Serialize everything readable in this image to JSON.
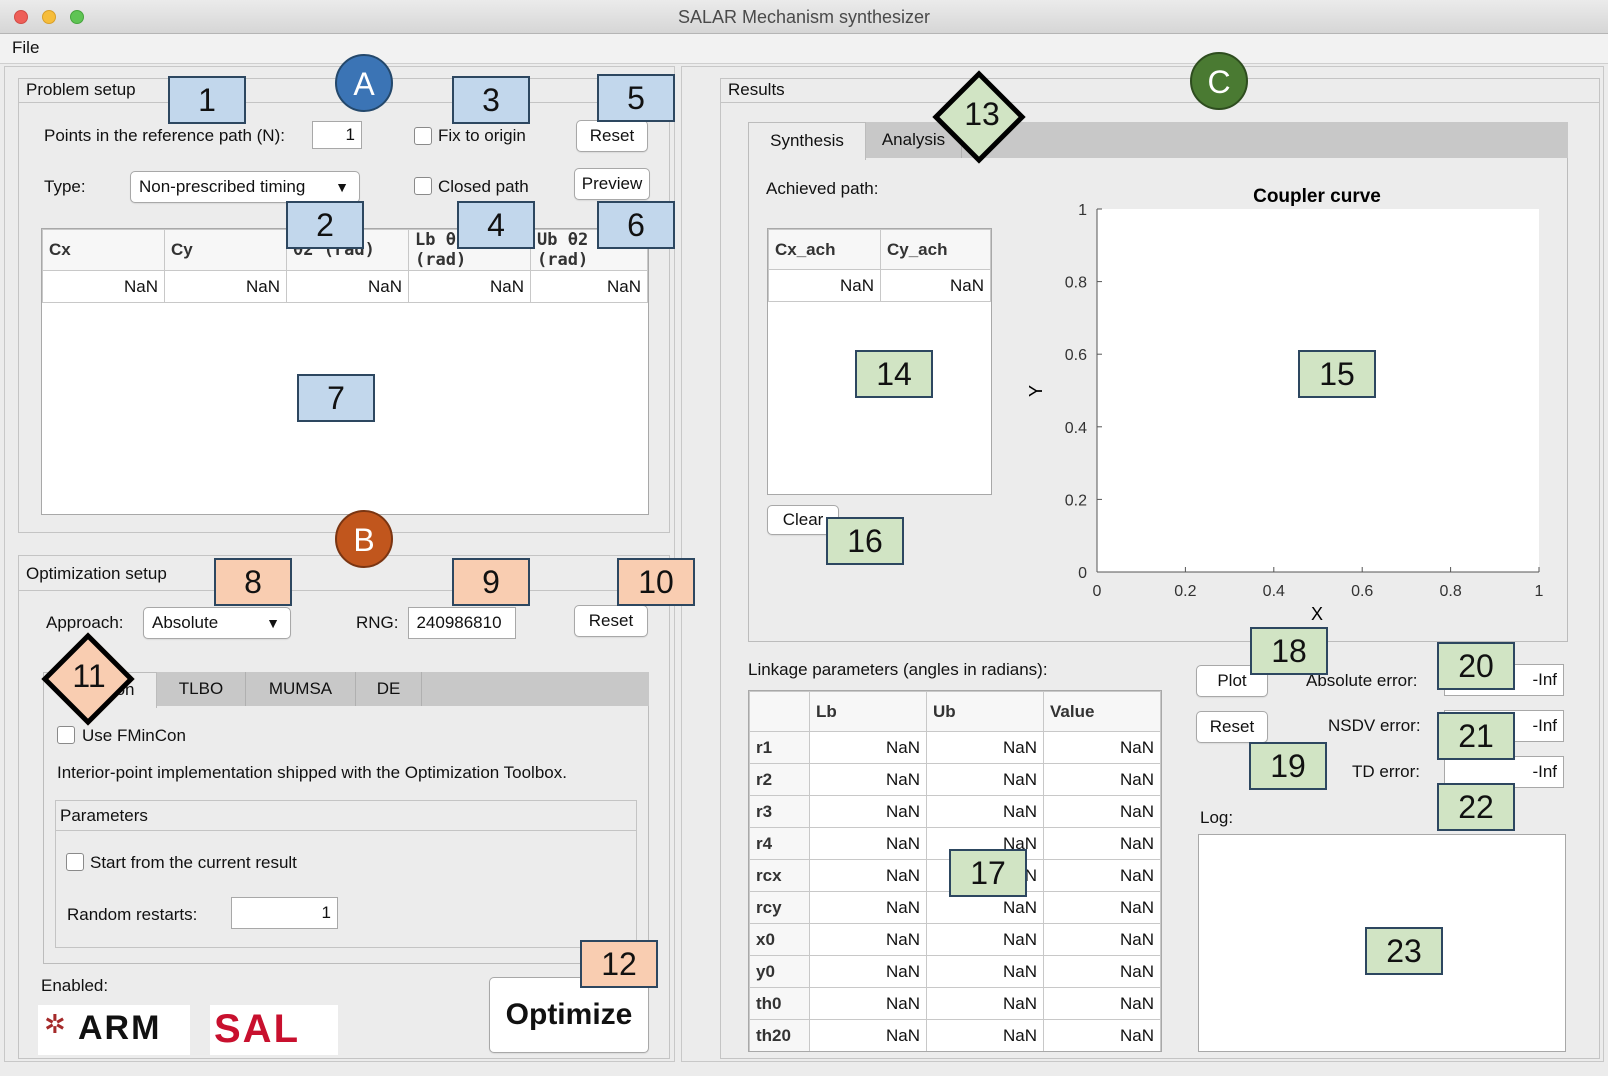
{
  "window": {
    "title": "SALAR Mechanism synthesizer"
  },
  "menu": {
    "file": "File"
  },
  "problem": {
    "title": "Problem setup",
    "points_label": "Points in the reference path (N):",
    "points_value": "1",
    "fix_origin": "Fix to origin",
    "reset": "Reset",
    "type_label": "Type:",
    "type_value": "Non-prescribed timing",
    "closed_path": "Closed path",
    "preview": "Preview",
    "table": {
      "headers": [
        "Cx",
        "Cy",
        "θ2 (rad)",
        "Lb θ2 (rad)",
        "Ub θ2 (rad)"
      ],
      "row": [
        "NaN",
        "NaN",
        "NaN",
        "NaN",
        "NaN"
      ]
    }
  },
  "optim": {
    "title": "Optimization setup",
    "approach_label": "Approach:",
    "approach_value": "Absolute",
    "rng_label": "RNG:",
    "rng_value": "240986810",
    "reset": "Reset",
    "tabs": [
      "FMinCon",
      "TLBO",
      "MUMSA",
      "DE"
    ],
    "use_fmincon": "Use FMinCon",
    "desc": "Interior-point implementation shipped with the Optimization Toolbox.",
    "params_title": "Parameters",
    "start_current": "Start from the current result",
    "restarts_label": "Random restarts:",
    "restarts_value": "1",
    "enabled": "Enabled:",
    "optimize": "Optimize",
    "logos": [
      "ARM",
      "SAL"
    ]
  },
  "results": {
    "title": "Results",
    "tabs": [
      "Synthesis",
      "Analysis"
    ],
    "achieved": "Achieved path:",
    "ach_table": {
      "headers": [
        "Cx_ach",
        "Cy_ach"
      ],
      "row": [
        "NaN",
        "NaN"
      ]
    },
    "clear": "Clear",
    "linkage_label": "Linkage parameters (angles in radians):",
    "linkage": {
      "headers": [
        "",
        "Lb",
        "Ub",
        "Value"
      ],
      "rows": [
        [
          "r1",
          "NaN",
          "NaN",
          "NaN"
        ],
        [
          "r2",
          "NaN",
          "NaN",
          "NaN"
        ],
        [
          "r3",
          "NaN",
          "NaN",
          "NaN"
        ],
        [
          "r4",
          "NaN",
          "NaN",
          "NaN"
        ],
        [
          "rcx",
          "NaN",
          "NaN",
          "NaN"
        ],
        [
          "rcy",
          "NaN",
          "NaN",
          "NaN"
        ],
        [
          "x0",
          "NaN",
          "NaN",
          "NaN"
        ],
        [
          "y0",
          "NaN",
          "NaN",
          "NaN"
        ],
        [
          "th0",
          "NaN",
          "NaN",
          "NaN"
        ],
        [
          "th20",
          "NaN",
          "NaN",
          "NaN"
        ]
      ]
    },
    "plot": "Plot",
    "reset": "Reset",
    "abs_error_label": "Absolute error:",
    "abs_error": "-Inf",
    "nsdv_label": "NSDV error:",
    "nsdv_error": "-Inf",
    "td_label": "TD error:",
    "td_error": "-Inf",
    "log_label": "Log:"
  },
  "chart_data": {
    "type": "line",
    "title": "Coupler curve",
    "xlabel": "X",
    "ylabel": "Y",
    "xlim": [
      0,
      1
    ],
    "ylim": [
      0,
      1
    ],
    "xticks": [
      "0",
      "0.2",
      "0.4",
      "0.6",
      "0.8",
      "1"
    ],
    "yticks": [
      "0",
      "0.2",
      "0.4",
      "0.6",
      "0.8",
      "1"
    ],
    "series": []
  },
  "annotations": {
    "circles": [
      "A",
      "B",
      "C"
    ],
    "labels": [
      "1",
      "2",
      "3",
      "4",
      "5",
      "6",
      "7",
      "8",
      "9",
      "10",
      "11",
      "12",
      "13",
      "14",
      "15",
      "16",
      "17",
      "18",
      "19",
      "20",
      "21",
      "22",
      "23"
    ]
  },
  "colors": {
    "blue_label": "#c2d7ec",
    "orange_label": "#f9cdb1",
    "green_label": "#d1e4c4",
    "circle_a": "#3b74b5",
    "circle_b": "#c1561d",
    "circle_c": "#4a7a32"
  }
}
